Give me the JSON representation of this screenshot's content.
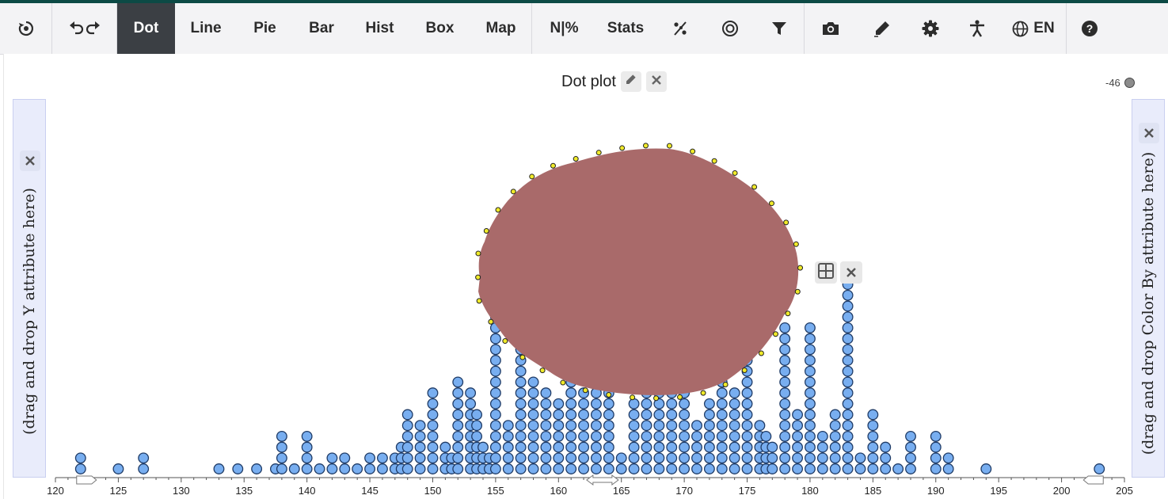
{
  "toolbar": {
    "undo_redo_label": "undo redo",
    "tabs": [
      {
        "label": "Dot",
        "active": true
      },
      {
        "label": "Line"
      },
      {
        "label": "Pie"
      },
      {
        "label": "Bar"
      },
      {
        "label": "Hist"
      },
      {
        "label": "Box"
      },
      {
        "label": "Map"
      },
      {
        "label": "N|%"
      },
      {
        "label": "Stats"
      }
    ],
    "language": "EN",
    "icons": [
      "reset-icon",
      "undo-icon",
      "redo-icon",
      "percent-scatter-icon",
      "target-icon",
      "filter-icon",
      "camera-icon",
      "pen-icon",
      "gear-icon",
      "accessibility-icon",
      "globe-icon",
      "help-icon"
    ]
  },
  "plot": {
    "title": "Dot plot",
    "legend_value": "-46",
    "y_drop_text": "(drag and drop Y attribute here)",
    "color_drop_text": "(drag and drop Color By attribute here)"
  },
  "colors": {
    "dot_fill": "#78aef0",
    "dot_stroke": "#1f3b66",
    "blob_fill": "#a96a6a",
    "blob_marker": "#f0ea2a",
    "active_tab_bg": "#3b3f44"
  },
  "chart_data": {
    "type": "scatter",
    "title": "Dot plot",
    "xlabel": "",
    "ylabel": "",
    "xlim": [
      120,
      205
    ],
    "x_ticks": [
      120,
      125,
      130,
      135,
      140,
      145,
      150,
      155,
      160,
      165,
      170,
      175,
      180,
      185,
      190,
      195,
      200,
      205
    ],
    "stacks": [
      {
        "x": 122,
        "count": 2
      },
      {
        "x": 125,
        "count": 1
      },
      {
        "x": 127,
        "count": 2
      },
      {
        "x": 133,
        "count": 1
      },
      {
        "x": 134.5,
        "count": 1
      },
      {
        "x": 136,
        "count": 1
      },
      {
        "x": 137.5,
        "count": 1
      },
      {
        "x": 138,
        "count": 4
      },
      {
        "x": 139,
        "count": 1
      },
      {
        "x": 140,
        "count": 4
      },
      {
        "x": 141,
        "count": 1
      },
      {
        "x": 142,
        "count": 2
      },
      {
        "x": 143,
        "count": 2
      },
      {
        "x": 144,
        "count": 1
      },
      {
        "x": 145,
        "count": 2
      },
      {
        "x": 146,
        "count": 2
      },
      {
        "x": 147,
        "count": 2
      },
      {
        "x": 147.5,
        "count": 3
      },
      {
        "x": 148,
        "count": 6
      },
      {
        "x": 149,
        "count": 5
      },
      {
        "x": 150,
        "count": 8
      },
      {
        "x": 151,
        "count": 3
      },
      {
        "x": 151.5,
        "count": 2
      },
      {
        "x": 152,
        "count": 9
      },
      {
        "x": 153,
        "count": 8
      },
      {
        "x": 153.5,
        "count": 6
      },
      {
        "x": 154,
        "count": 3
      },
      {
        "x": 154.5,
        "count": 2
      },
      {
        "x": 155,
        "count": 16
      },
      {
        "x": 156,
        "count": 5
      },
      {
        "x": 157,
        "count": 12
      },
      {
        "x": 158,
        "count": 9
      },
      {
        "x": 159,
        "count": 8
      },
      {
        "x": 160,
        "count": 7
      },
      {
        "x": 161,
        "count": 9
      },
      {
        "x": 162,
        "count": 8
      },
      {
        "x": 163,
        "count": 8
      },
      {
        "x": 164,
        "count": 9
      },
      {
        "x": 165,
        "count": 2
      },
      {
        "x": 166,
        "count": 7
      },
      {
        "x": 167,
        "count": 8
      },
      {
        "x": 168,
        "count": 9
      },
      {
        "x": 169,
        "count": 8
      },
      {
        "x": 170,
        "count": 8
      },
      {
        "x": 171,
        "count": 5
      },
      {
        "x": 172,
        "count": 7
      },
      {
        "x": 173,
        "count": 9
      },
      {
        "x": 174,
        "count": 8
      },
      {
        "x": 175,
        "count": 12
      },
      {
        "x": 176,
        "count": 5
      },
      {
        "x": 176.5,
        "count": 4
      },
      {
        "x": 177,
        "count": 3
      },
      {
        "x": 178,
        "count": 14
      },
      {
        "x": 179,
        "count": 6
      },
      {
        "x": 180,
        "count": 14
      },
      {
        "x": 181,
        "count": 4
      },
      {
        "x": 182,
        "count": 6
      },
      {
        "x": 183,
        "count": 19
      },
      {
        "x": 184,
        "count": 2
      },
      {
        "x": 185,
        "count": 6
      },
      {
        "x": 186,
        "count": 3
      },
      {
        "x": 187,
        "count": 1
      },
      {
        "x": 188,
        "count": 4
      },
      {
        "x": 190,
        "count": 4
      },
      {
        "x": 191,
        "count": 2
      },
      {
        "x": 194,
        "count": 1
      },
      {
        "x": 203,
        "count": 1
      }
    ]
  }
}
